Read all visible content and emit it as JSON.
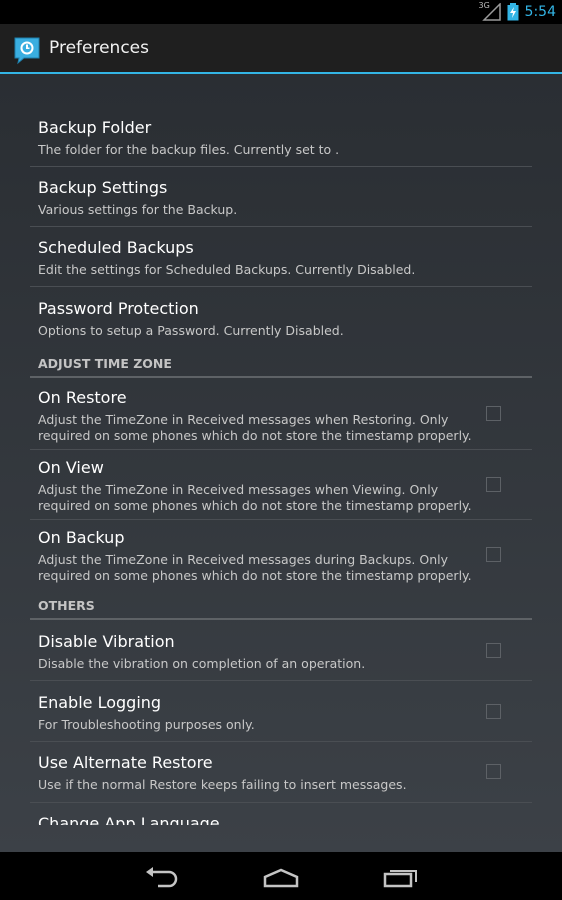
{
  "status_bar": {
    "network": "3G",
    "time": "5:54"
  },
  "action_bar": {
    "title": "Preferences",
    "app_icon": "sms-backup-app-icon"
  },
  "preferences": [
    {
      "title": "Backup Folder",
      "summary": "The folder for the backup files. Currently set to ."
    },
    {
      "title": "Backup Settings",
      "summary": "Various settings for the Backup."
    },
    {
      "title": "Scheduled Backups",
      "summary": "Edit the settings for Scheduled Backups. Currently Disabled."
    },
    {
      "title": "Password Protection",
      "summary": "Options to setup a Password. Currently Disabled."
    }
  ],
  "adjust_time_zone": {
    "header": "ADJUST TIME ZONE",
    "items": [
      {
        "title": "On Restore",
        "summary": "Adjust the TimeZone in Received messages when Restoring. Only required on some phones which do not store the timestamp properly.",
        "checked": false
      },
      {
        "title": "On View",
        "summary": "Adjust the TimeZone in Received messages when Viewing. Only required on some phones which do not store the timestamp properly.",
        "checked": false
      },
      {
        "title": "On Backup",
        "summary": "Adjust the TimeZone in Received messages during Backups. Only required on some phones which do not store the timestamp properly.",
        "checked": false
      }
    ]
  },
  "others": {
    "header": "OTHERS",
    "items": [
      {
        "title": "Disable Vibration",
        "summary": "Disable the vibration on completion of an operation.",
        "checked": false
      },
      {
        "title": "Enable Logging",
        "summary": "For Troubleshooting purposes only.",
        "checked": false
      },
      {
        "title": "Use Alternate Restore",
        "summary": "Use if the normal Restore keeps failing to insert messages.",
        "checked": false
      },
      {
        "title": "Change App Language"
      }
    ]
  },
  "nav_bar": {
    "back_icon": "back-icon",
    "home_icon": "home-icon",
    "recents_icon": "recents-icon"
  },
  "colors": {
    "accent": "#33b5e5",
    "background_top": "#2a2e33",
    "background_bottom": "#3c4147"
  }
}
